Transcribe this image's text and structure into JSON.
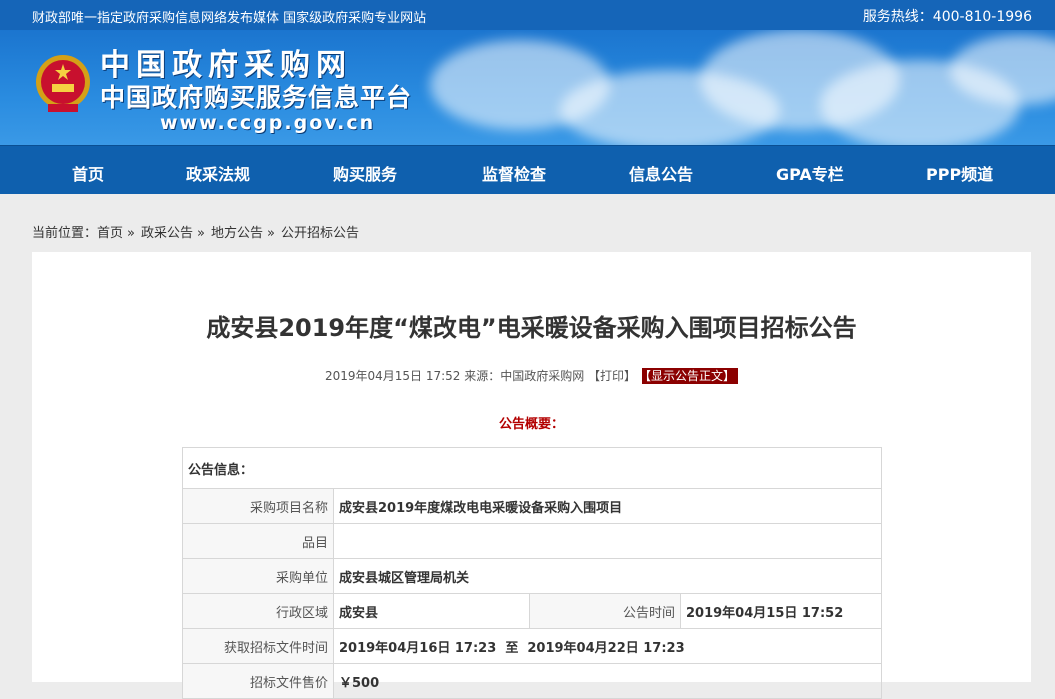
{
  "topbar": {
    "slogan": "财政部唯一指定政府采购信息网络发布媒体 国家级政府采购专业网站",
    "hotline": "服务热线：400-810-1996"
  },
  "banner": {
    "name": "中国政府采购网",
    "subtitle": "中国政府购买服务信息平台",
    "url": "www.ccgp.gov.cn"
  },
  "nav": [
    "首页",
    "政采法规",
    "购买服务",
    "监督检查",
    "信息公告",
    "GPA专栏",
    "PPP频道"
  ],
  "breadcrumb": {
    "prefix": "当前位置：",
    "items": [
      "首页",
      "政采公告",
      "地方公告",
      "公开招标公告"
    ]
  },
  "article": {
    "title": "成安县2019年度“煤改电”电采暖设备采购入围项目招标公告",
    "meta": "2019年04月15日 17:52 来源：中国政府采购网 【打印】",
    "show_label": "【显示公告正文】",
    "summary_label": "公告概要："
  },
  "info_table": {
    "header": "公告信息：",
    "project_name_label": "采购项目名称",
    "project_name": "成安县2019年度煤改电电采暖设备采购入围项目",
    "item_label": "品目",
    "item": "",
    "buyer_label": "采购单位",
    "buyer": "成安县城区管理局机关",
    "region_label": "行政区域",
    "region": "成安县",
    "notice_time_label": "公告时间",
    "notice_time": "2019年04月15日 17:52",
    "doc_time_label": "获取招标文件时间",
    "doc_time": "2019年04月16日 17:23  至  2019年04月22日 17:23",
    "price_label": "招标文件售价",
    "price": "￥500"
  }
}
